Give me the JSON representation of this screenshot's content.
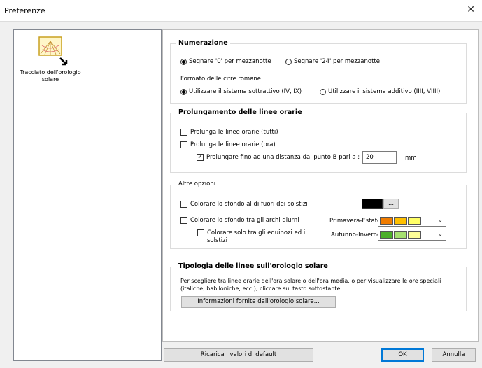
{
  "window": {
    "title": "Preferenze",
    "close_glyph": "✕"
  },
  "sidebar": {
    "items": [
      {
        "label": "Tracciato dell'orologio solare",
        "icon": "sundial-icon"
      }
    ]
  },
  "numerazione": {
    "title": "Numerazione",
    "opt_zero": "Segnare '0' per mezzanotte",
    "opt_24": "Segnare '24' per mezzanotte",
    "roman_label": "Formato delle cifre romane",
    "opt_sottrattivo": "Utilizzare il sistema sottrattivo (IV, IX)",
    "opt_additivo": "Utilizzare il sistema additivo (IIII, VIIII)",
    "selected_midnight": "0",
    "selected_roman": "sottrattivo"
  },
  "prolungamento": {
    "title": "Prolungamento delle linee orarie",
    "opt_tutti": "Prolunga le linee orarie (tutti)",
    "opt_ora": "Prolunga le linee orarie (ora)",
    "opt_distanza": "Prolungare fino ad una distanza dal punto B pari a  :",
    "distance_value": "20",
    "unit": "mm",
    "checked_tutti": false,
    "checked_ora": false,
    "checked_distanza": true
  },
  "altre": {
    "title": "Altre opzioni",
    "opt_solstizi": "Colorare lo sfondo al di fuori dei solstizi",
    "solstizi_color": "#000000",
    "browse_label": "...",
    "opt_archi": "Colorare lo sfondo tra gli archi diurni",
    "opt_equinozi": "Colorare solo tra gli equinozi ed i solstizi",
    "primavera_label": "Primavera-Estate :",
    "autunno_label": "Autunno-Inverno :",
    "primavera_colors": [
      "#f07c00",
      "#ffc000",
      "#ffff66"
    ],
    "autunno_colors": [
      "#4caf2a",
      "#a6e070",
      "#ffff99"
    ],
    "dropdown_glyph": "⌄"
  },
  "tipologia": {
    "title": "Tipologia delle linee sull'orologio solare",
    "desc1": "Per scegliere tra linee orarie dell'ora solare o dell'ora media, o per visualizzare le ore speciali",
    "desc2": "(italiche, babiloniche, ecc.), cliccare sul tasto sottostante.",
    "info_button": "Informazioni fornite dall'orologio solare..."
  },
  "footer": {
    "reset_button": "Ricarica i valori di default",
    "ok_button": "OK",
    "cancel_button": "Annulla"
  }
}
